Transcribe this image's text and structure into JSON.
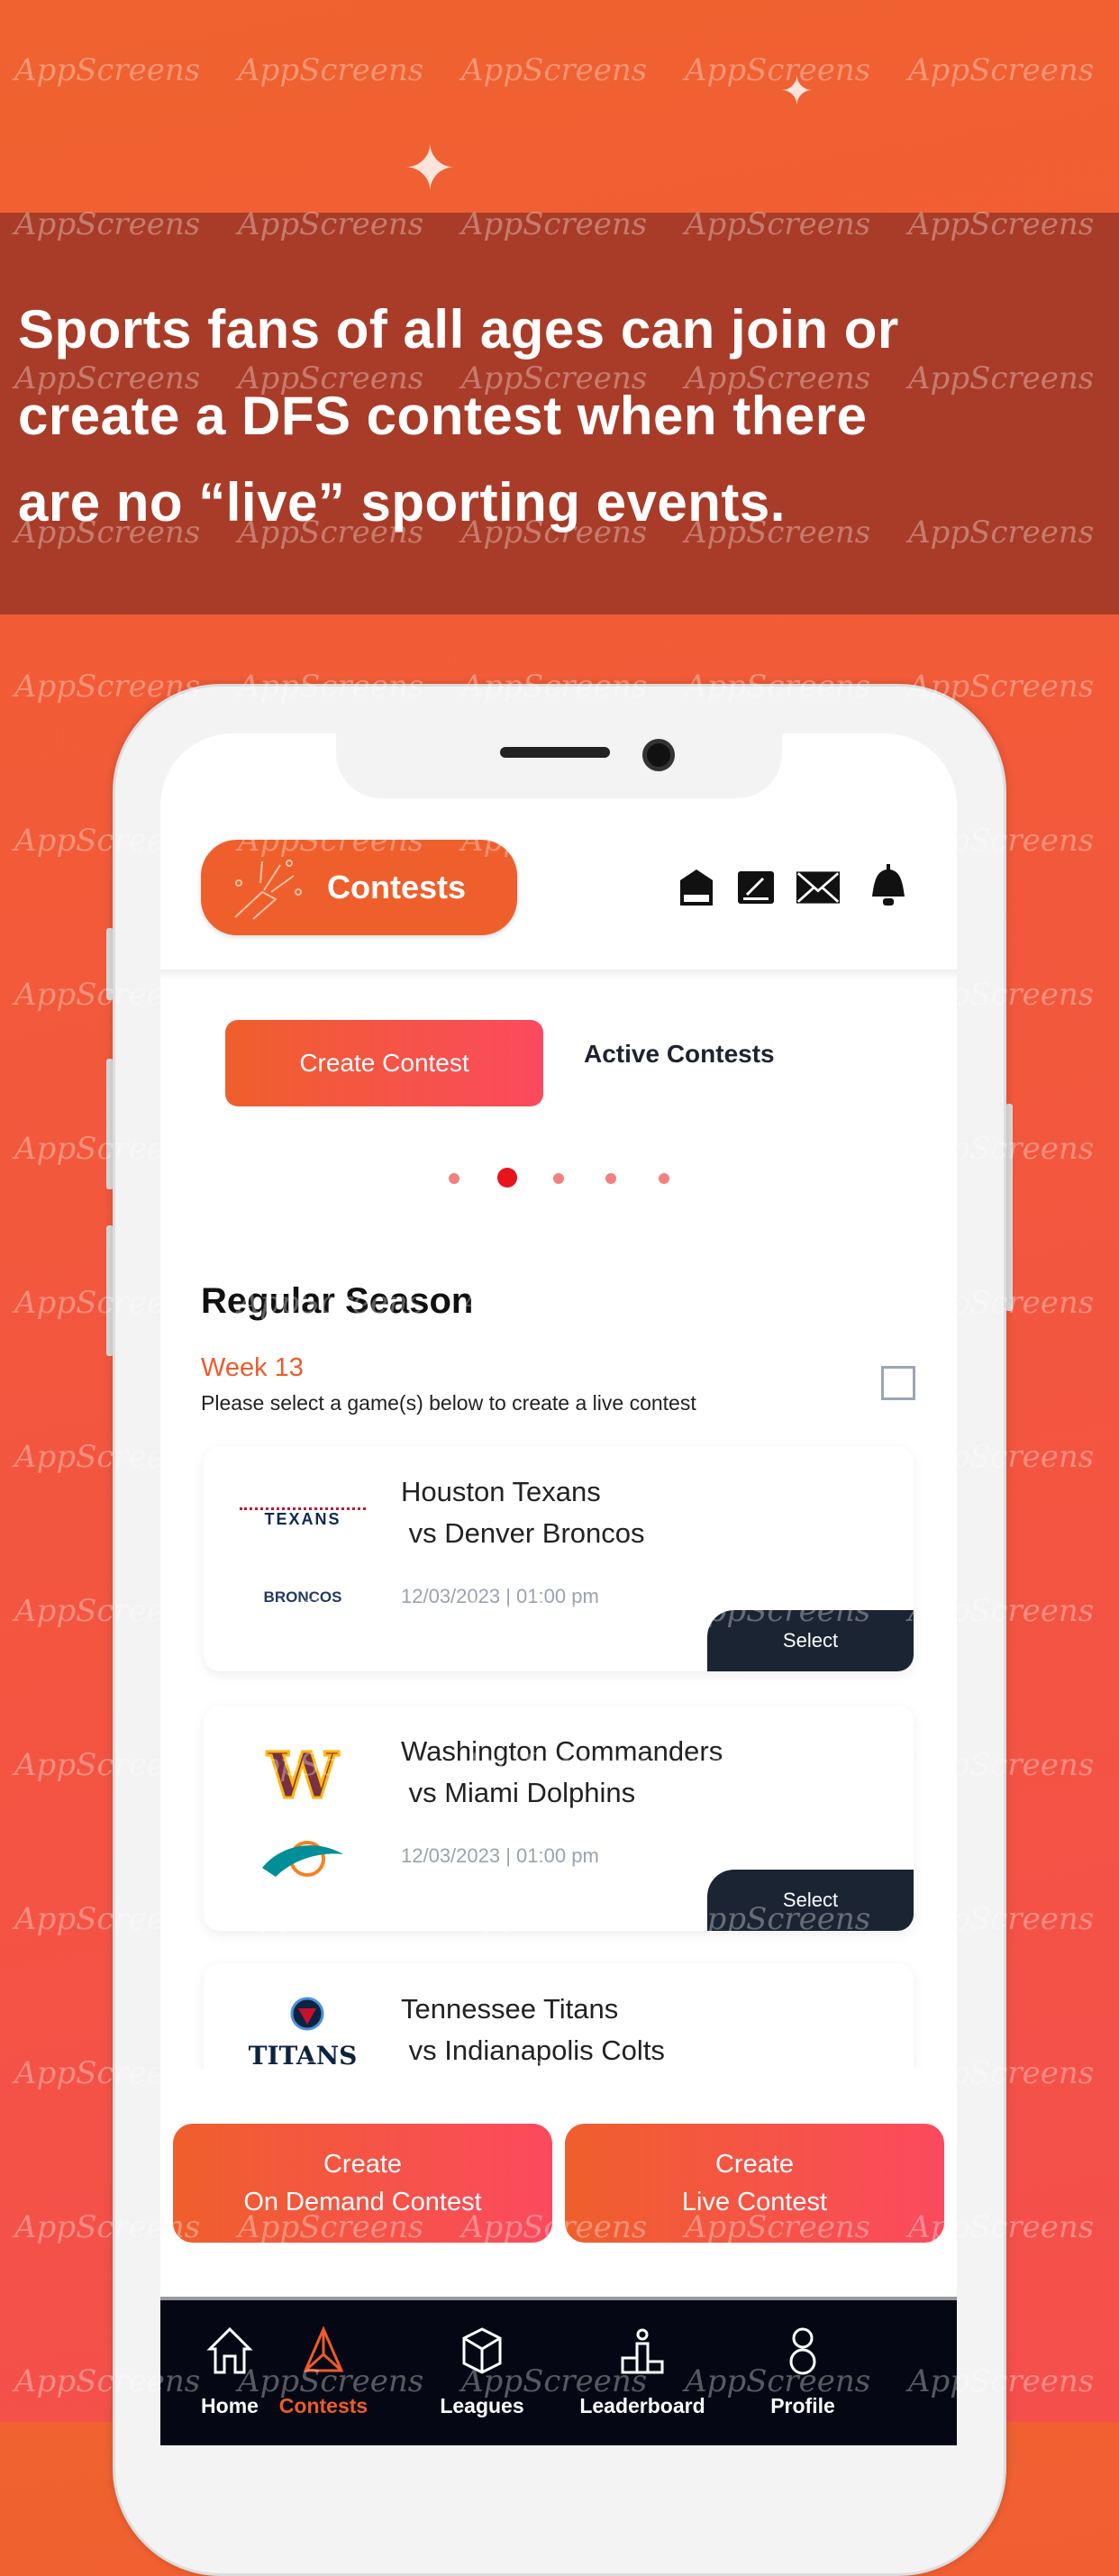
{
  "watermark": "AppScreens",
  "headline": [
    "Sports fans of all ages can join or",
    "create a DFS contest when there",
    "are no “live” sporting events."
  ],
  "app": {
    "header": {
      "title": "Contests",
      "icons": [
        "news-icon",
        "blog-icon",
        "mail-icon",
        "bell-icon"
      ]
    },
    "tabs": [
      {
        "label": "Create Contest",
        "active": true
      },
      {
        "label": "Active Contests",
        "active": false
      }
    ],
    "carousel": {
      "count": 5,
      "active_index": 1
    },
    "section_title": "Regular Season",
    "week": "Week 13",
    "instruction": "Please select a game(s) below to create a live contest",
    "select_all_checked": false,
    "games": [
      {
        "home": "Houston Texans",
        "away": " vs Denver Broncos",
        "home_logo": "TEXANS",
        "away_logo": "BRONCOS",
        "datetime": "12/03/2023 | 01:00 pm",
        "button": "Select"
      },
      {
        "home": "Washington Commanders",
        "away": " vs Miami Dolphins",
        "home_logo": "W",
        "away_logo": "dolphin",
        "datetime": "12/03/2023 | 01:00 pm",
        "button": "Select"
      },
      {
        "home": "Tennessee Titans",
        "away": " vs Indianapolis Colts",
        "home_logo": "TITANS",
        "away_logo": "",
        "datetime": "",
        "button": ""
      }
    ],
    "actions": [
      {
        "line1": "Create",
        "line2": "On Demand Contest"
      },
      {
        "line1": "Create",
        "line2": "Live Contest"
      }
    ],
    "nav": [
      {
        "label": "Home",
        "icon": "home-icon"
      },
      {
        "label": "Contests",
        "icon": "contests-icon",
        "active": true
      },
      {
        "label": "Leagues",
        "icon": "leagues-icon"
      },
      {
        "label": "Leaderboard",
        "icon": "leaderboard-icon"
      },
      {
        "label": "Profile",
        "icon": "profile-icon"
      }
    ],
    "colors": {
      "accent": "#ef5f2c",
      "accent_end": "#fb4a5e",
      "nav_bg": "#050814",
      "select_btn": "#1b2433"
    }
  }
}
